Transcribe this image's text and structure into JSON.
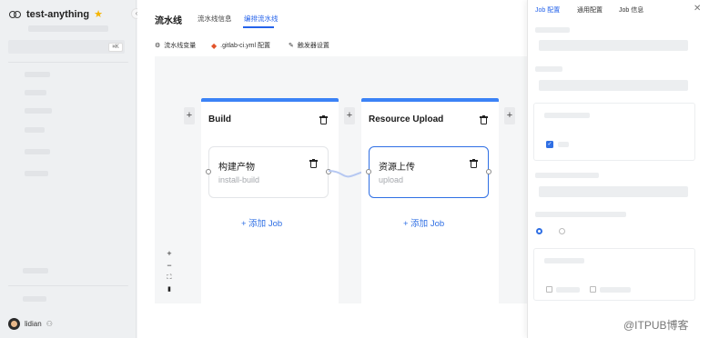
{
  "project": {
    "name": "test-anything",
    "shortcut": "⌘K"
  },
  "user": {
    "name": "lidian"
  },
  "header": {
    "title": "流水线",
    "tabs": [
      {
        "label": "流水线信息",
        "active": false
      },
      {
        "label": "编排流水线",
        "active": true
      }
    ]
  },
  "subtabs": [
    {
      "label": "流水线变量",
      "icon": "settings-icon"
    },
    {
      "label": ".gitlab-ci.yml 配置",
      "icon": "gitlab-icon"
    },
    {
      "label": "触发器设置",
      "icon": "edit-icon"
    }
  ],
  "stages": [
    {
      "title": "Build",
      "jobs": [
        {
          "name": "构建产物",
          "script": "install-build",
          "selected": false
        }
      ],
      "add_job_label": "+ 添加 Job"
    },
    {
      "title": "Resource Upload",
      "jobs": [
        {
          "name": "资源上传",
          "script": "upload",
          "selected": true
        }
      ],
      "add_job_label": "+ 添加 Job"
    }
  ],
  "add_stage_label": "+",
  "zoom_controls": [
    "+",
    "−",
    "⛶",
    "🔒"
  ],
  "panel": {
    "tabs": [
      {
        "label": "Job 配置",
        "active": true
      },
      {
        "label": "通用配置",
        "active": false
      },
      {
        "label": "Job 信息",
        "active": false
      }
    ],
    "close_label": "✕"
  },
  "watermark": "@ITPUB博客",
  "colors": {
    "accent": "#2563eb",
    "stage_bar": "#3b82f6"
  }
}
